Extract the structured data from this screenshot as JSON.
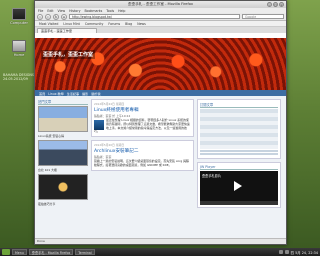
{
  "desktop": {
    "icons": [
      {
        "label": "Computer"
      },
      {
        "label": "Home"
      }
    ],
    "note_lines": [
      "BAHAMA DESIGNS",
      "24.05.2012/09"
    ]
  },
  "window": {
    "title": "歪歪手札 - 歪歪工作室 - Mozilla Firefox",
    "menu": [
      "File",
      "Edit",
      "View",
      "History",
      "Bookmarks",
      "Tools",
      "Help"
    ],
    "url": "http://ewing.blogspot.tw/",
    "search_placeholder": "Google",
    "bookmarks": [
      "Most Visited",
      "Linux Mint",
      "Community",
      "Forums",
      "Blog",
      "News"
    ],
    "tab": "歪歪手札 - 歪歪工作室",
    "status": "Done"
  },
  "page": {
    "banner_title": "歪歪手札，歪歪工作室",
    "nav": [
      "首頁",
      "Linux 教學",
      "生活記事",
      "攝影",
      "關於我"
    ],
    "left": {
      "head": "熱門文章",
      "captions": [
        "Linux系統 安裝心得",
        "台北 101 大樓",
        "夜拍技巧分享"
      ]
    },
    "posts": [
      {
        "date": "2012年5月24日 星期四",
        "title": "Linux終極使用者專輯",
        "meta": "張貼者：歪歪 於 上午10:24",
        "body": "最近在整理 Linux 相關的資料，發現很多人對於 Linux 系統的使用仍有疑問，所以特別整理了這篇文章，希望能夠幫助大家更快速地上手。本文將介紹常用的指令與設定方法，以及一些實用的技巧。"
      },
      {
        "date": "2012年5月20日 星期日",
        "title": "Archlinux安裝筆記二",
        "meta": "張貼者：歪歪",
        "body": "延續上一篇的安裝說明，這次要介紹桌面環境的設定。首先安裝 xorg 與驅動程式，接著選擇喜歡的桌面環境，例如 GNOME 或 KDE。"
      }
    ],
    "right": {
      "head1": "訂閱文章",
      "head2": "JW Player",
      "video_title": "歪歪手札影片"
    }
  },
  "taskbar": {
    "items": [
      "Menu",
      "歪歪手札 - Mozilla Firefox",
      "Terminal"
    ],
    "clock": "四 5月 24, 22:34"
  }
}
